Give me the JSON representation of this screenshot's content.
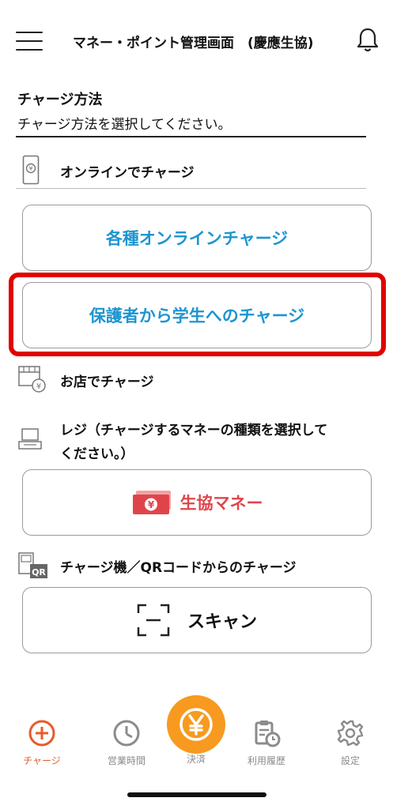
{
  "header": {
    "title": "マネー・ポイント管理画面　(慶應生協)"
  },
  "charge": {
    "heading": "チャージ方法",
    "subtitle": "チャージ方法を選択してください。"
  },
  "online": {
    "label": "オンラインでチャージ",
    "various_label": "各種オンラインチャージ",
    "guardian_label": "保護者から学生へのチャージ"
  },
  "store": {
    "label": "お店でチャージ",
    "register_label_line1": "レジ（チャージするマネーの種類を選択して",
    "register_label_line2": "ください。）",
    "coop_money_label": "生協マネー",
    "machine_label": "チャージ機／QRコードからのチャージ",
    "scan_label": "スキャン",
    "qr_badge": "QR"
  },
  "tabs": {
    "charge": "チャージ",
    "hours": "営業時間",
    "pay": "決済",
    "history": "利用履歴",
    "settings": "設定"
  },
  "colors": {
    "accent_blue": "#1d95d1",
    "highlight_red": "#e20000",
    "money_red": "#e0444b",
    "active_tab": "#e85a2a",
    "pay_orange": "#f79a1f"
  }
}
